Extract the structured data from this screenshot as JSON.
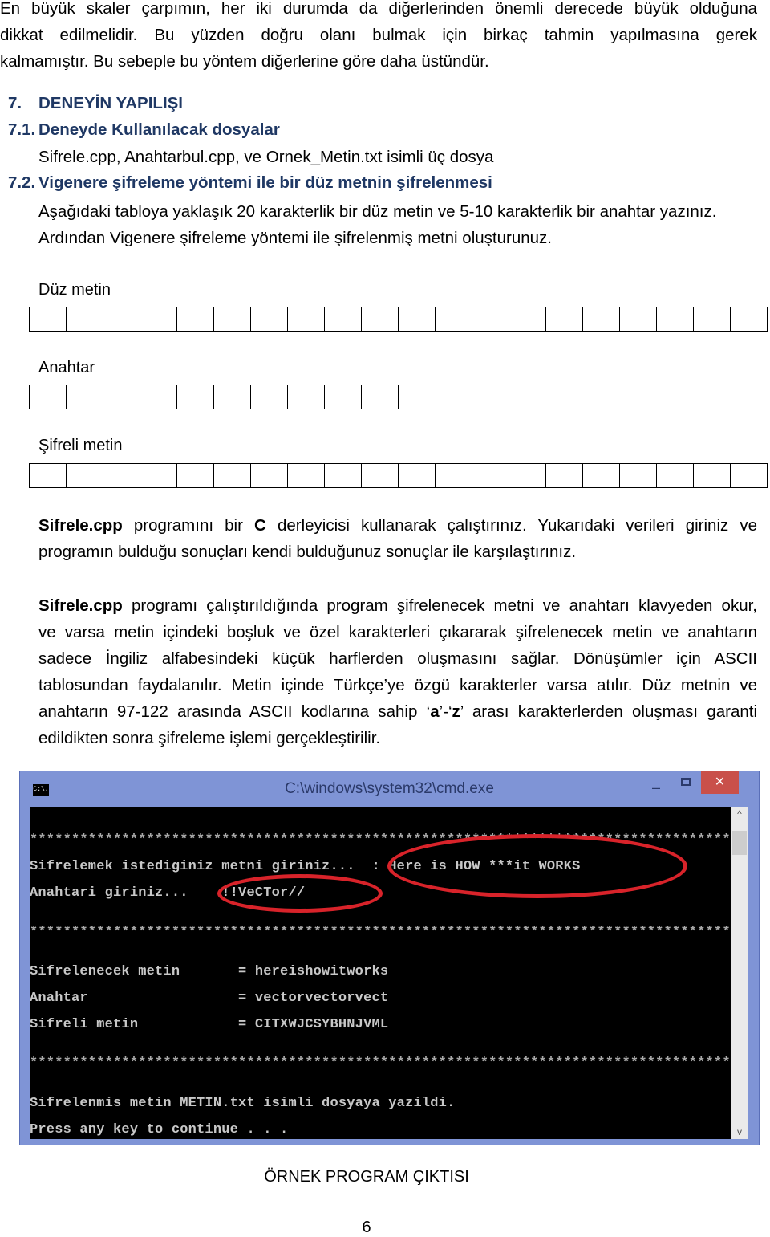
{
  "intro_paragraph": [
    "En büyük skaler çarpımın, her iki durumda da diğerlerinden önemli derecede büyük olduğuna",
    "dikkat edilmelidir. Bu yüzden doğru olanı bulmak için birkaç tahmin yapılmasına gerek",
    "kalmamıştır. Bu sebeple bu yöntem diğerlerine göre daha üstündür."
  ],
  "section7": {
    "number": "7.",
    "title": "DENEYİN YAPILIŞI"
  },
  "section71": {
    "number": "7.1.",
    "title": "Deneyde Kullanılacak dosyalar",
    "text": "Sifrele.cpp, Anahtarbul.cpp, ve Ornek_Metin.txt isimli üç dosya"
  },
  "section72": {
    "number": "7.2.",
    "title": "Vigenere şifreleme yöntemi ile bir düz metnin şifrelenmesi",
    "lines": [
      "Aşağıdaki tabloya yaklaşık 20 karakterlik bir düz metin ve 5-10 karakterlik bir anahtar yazınız.",
      "Ardından Vigenere şifreleme yöntemi ile şifrelenmiş metni oluşturunuz."
    ]
  },
  "tables": {
    "plain_label": "Düz metin",
    "plain_cells": 20,
    "key_label": "Anahtar",
    "key_cells": 10,
    "cipher_label": "Şifreli metin",
    "cipher_cells": 20
  },
  "para1": {
    "bold1": "Sifrele.cpp",
    "t1": " programını bir ",
    "bold2": "C",
    "t2": " derleyicisi kullanarak çalıştırınız. Yukarıdaki verileri giriniz ve",
    "line2": "programın bulduğu sonuçları kendi bulduğunuz sonuçlar ile karşılaştırınız."
  },
  "para2": {
    "bold1": "Sifrele.cpp",
    "t1": " programı çalıştırıldığında program şifrelenecek metni ve anahtarı klavyeden okur,",
    "lines": [
      "ve varsa metin içindeki boşluk ve özel karakterleri çıkararak şifrelenecek metin ve anahtarın",
      "sadece İngiliz alfabesindeki küçük harflerden oluşmasını sağlar. Dönüşümler için ASCII",
      "tablosundan faydalanılır. Metin içinde Türkçe’ye özgü karakterler varsa atılır. Düz metnin ve"
    ],
    "l5a": "anahtarın 97-122 arasında ASCII kodlarına sahip ‘",
    "l5b": "a",
    "l5c": "’-‘",
    "l5d": "z",
    "l5e": "’ arası karakterlerden oluşması garanti",
    "line6": "edildikten sonra şifreleme işlemi gerçekleştirilir."
  },
  "cmd": {
    "title": "C:\\windows\\system32\\cmd.exe",
    "icon_text": "C:\\.",
    "stars": "*****************************************************************************************",
    "lines": [
      "Sifrelemek istediginiz metni giriniz...  : Here is HOW ***it WORKS",
      "Anahtari giriniz...    !!VeCTor//",
      "Sifrelenecek metin       = hereishowitworks",
      "Anahtar                  = vectorvectorvect",
      "Sifreli metin            = CITXWJCSYBHNJVML",
      "Sifrelenmis metin METIN.txt isimli dosyaya yazildi.",
      "Press any key to continue . . ."
    ],
    "highlight_color": "#d8232a"
  },
  "caption": "ÖRNEK PROGRAM ÇIKTISI",
  "page_number": "6"
}
